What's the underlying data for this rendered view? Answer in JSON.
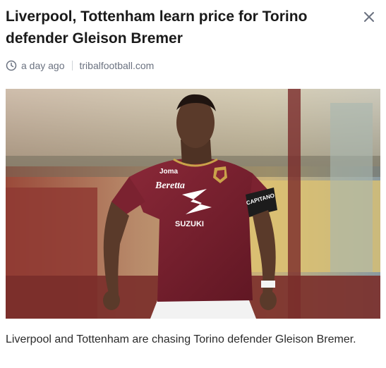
{
  "article": {
    "title": "Liverpool, Tottenham learn price for Torino defender Gleison Bremer",
    "time": "a day ago",
    "source": "tribalfootball.com",
    "summary": "Liverpool and Tottenham are chasing Torino defender Gleison Bremer."
  },
  "photo": {
    "jersey_brand": "Joma",
    "sponsor_front": "Beretta",
    "sponsor_main": "SUZUKI",
    "armband": "CAPITANO"
  },
  "icons": {
    "close": "close-icon",
    "time": "clock-icon"
  },
  "colors": {
    "title": "#1a1a1a",
    "meta": "#6b7280",
    "close": "#6b7280",
    "jersey": "#7b2230"
  }
}
